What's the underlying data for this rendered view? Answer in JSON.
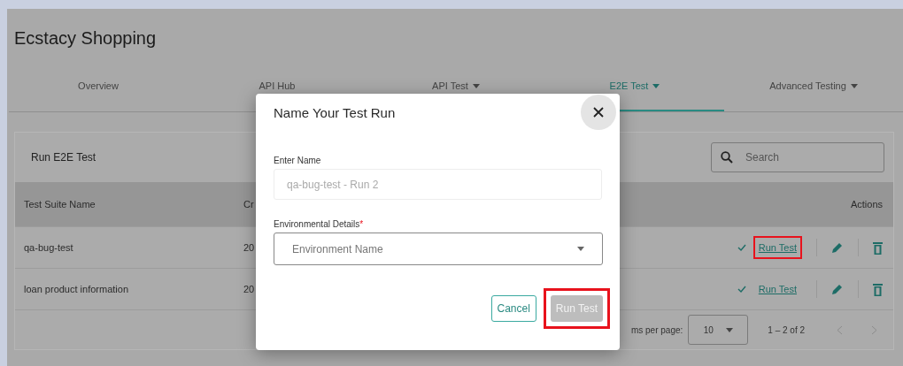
{
  "page": {
    "title": "Ecstacy Shopping"
  },
  "tabs": [
    {
      "label": "Overview",
      "selected": false,
      "dropdown": false
    },
    {
      "label": "API Hub",
      "selected": false,
      "dropdown": false
    },
    {
      "label": "API Test",
      "selected": false,
      "dropdown": true
    },
    {
      "label": "E2E Test",
      "selected": true,
      "dropdown": true
    },
    {
      "label": "Advanced Testing",
      "selected": false,
      "dropdown": true
    }
  ],
  "card": {
    "title": "Run E2E Test",
    "search": {
      "placeholder": "Search"
    },
    "table": {
      "columns": [
        "Test Suite Name",
        "Cr",
        "Actions"
      ],
      "rows": [
        {
          "cells": [
            "qa-bug-test",
            "20"
          ],
          "action": "Run Test",
          "highlighted": true
        },
        {
          "cells": [
            "loan product information",
            "20"
          ],
          "action": "Run Test",
          "highlighted": false
        }
      ]
    },
    "pagination": {
      "items_per_page_label": "ms per page:",
      "page_size": "10",
      "range": "1 – 2 of 2"
    }
  },
  "modal": {
    "title": "Name Your Test Run",
    "name_field": {
      "label": "Enter Name",
      "placeholder": "qa-bug-test - Run 2"
    },
    "env_field": {
      "label": "Environmental Details",
      "required_mark": "*",
      "placeholder": "Environment Name"
    },
    "buttons": [
      {
        "label": "Cancel",
        "kind": "outline",
        "disabled": false,
        "highlighted": false
      },
      {
        "label": "Run Test",
        "kind": "filled",
        "disabled": true,
        "highlighted": true
      }
    ]
  }
}
